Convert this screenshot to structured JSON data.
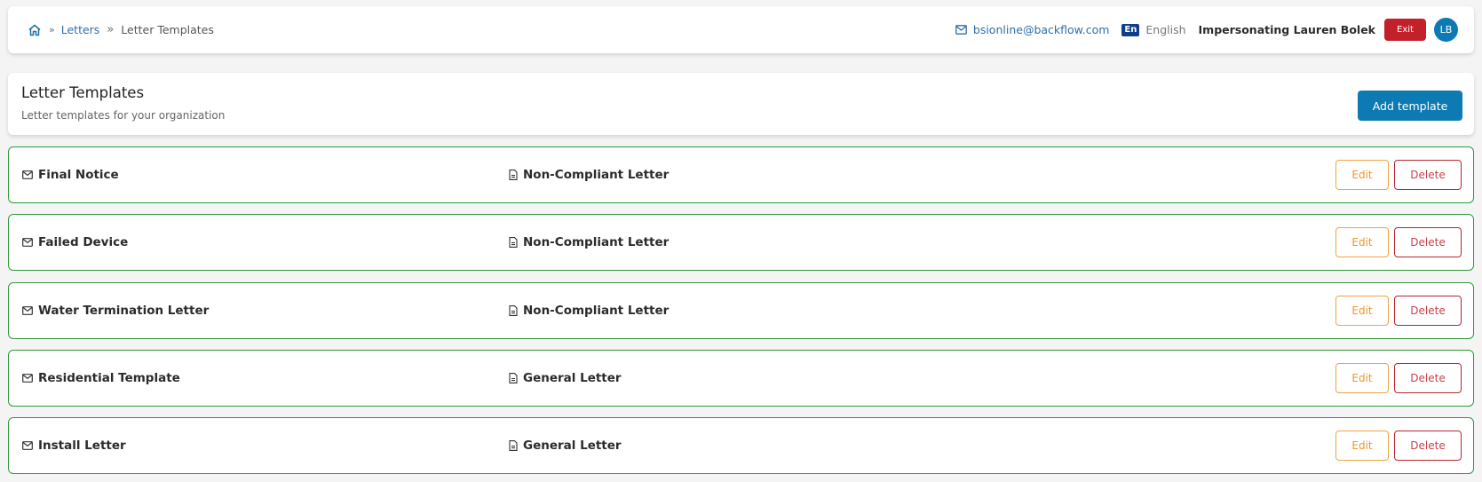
{
  "breadcrumb": {
    "home_icon": "home-icon",
    "items": [
      {
        "label": "Letters",
        "link": true
      },
      {
        "label": "Letter Templates",
        "link": false
      }
    ]
  },
  "header": {
    "email": "bsionline@backflow.com",
    "email_icon": "mail-icon",
    "language_code": "En",
    "language": "English",
    "impersonating": "Impersonating Lauren Bolek",
    "exit_label": "Exit",
    "avatar_initials": "LB"
  },
  "colors": {
    "primary": "#0d7ab3",
    "exit": "#c4202a",
    "row_border": "#2e9a38",
    "edit": "#f0962e",
    "delete": "#c8424a"
  },
  "page": {
    "title": "Letter Templates",
    "subtitle": "Letter templates for your organization",
    "add_label": "Add template"
  },
  "templates": [
    {
      "name": "Final Notice",
      "type": "Non-Compliant Letter",
      "edit_label": "Edit",
      "delete_label": "Delete"
    },
    {
      "name": "Failed Device",
      "type": "Non-Compliant Letter",
      "edit_label": "Edit",
      "delete_label": "Delete"
    },
    {
      "name": "Water Termination Letter",
      "type": "Non-Compliant Letter",
      "edit_label": "Edit",
      "delete_label": "Delete"
    },
    {
      "name": "Residential Template",
      "type": "General Letter",
      "edit_label": "Edit",
      "delete_label": "Delete"
    },
    {
      "name": "Install Letter",
      "type": "General Letter",
      "edit_label": "Edit",
      "delete_label": "Delete"
    }
  ]
}
